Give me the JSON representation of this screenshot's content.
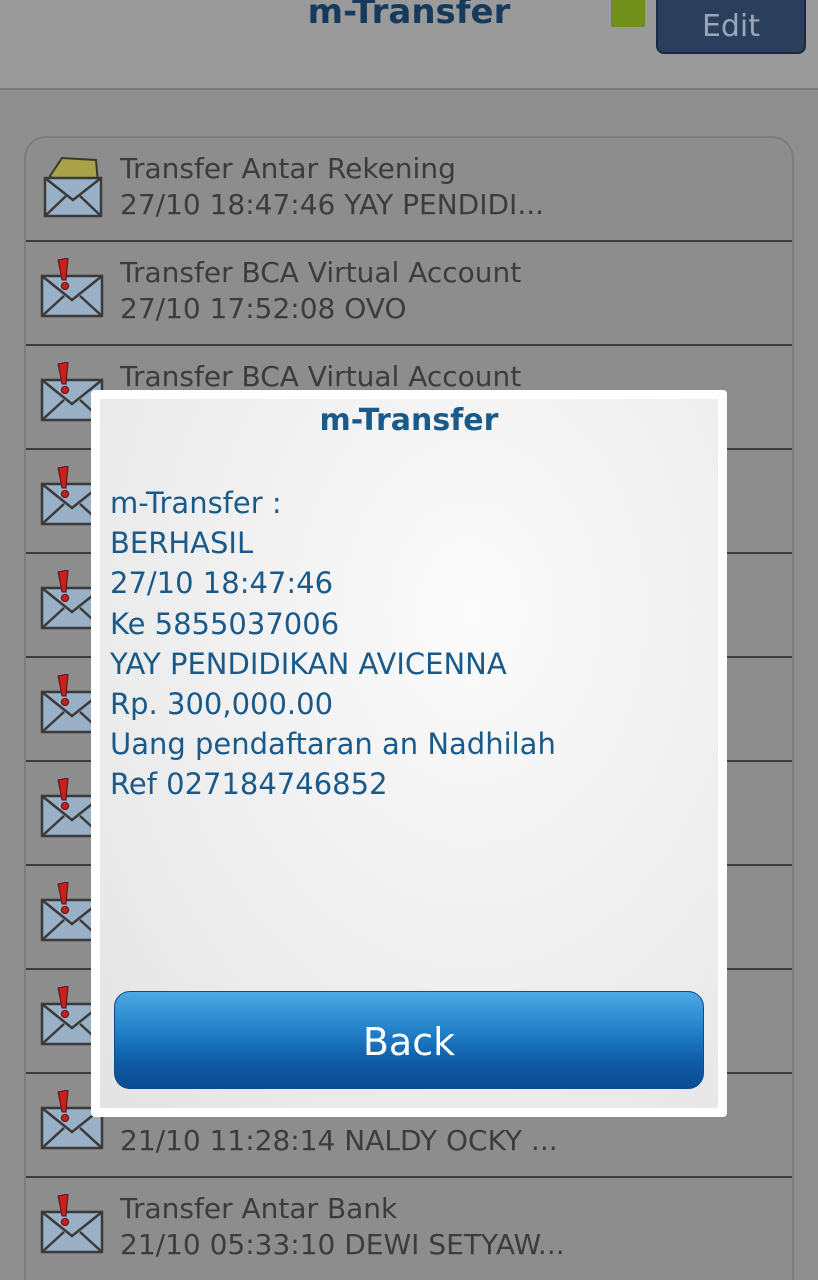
{
  "header": {
    "title": "m-Transfer",
    "edit_label": "Edit",
    "status_color": "#6f8f1a"
  },
  "list": {
    "items": [
      {
        "icon": "envelope-open-icon",
        "title": "Transfer Antar Rekening",
        "sub": "27/10 18:47:46 YAY PENDIDI..."
      },
      {
        "icon": "envelope-alert-icon",
        "title": "Transfer BCA Virtual Account",
        "sub": "27/10 17:52:08 OVO"
      },
      {
        "icon": "envelope-alert-icon",
        "title": "Transfer BCA Virtual Account",
        "sub": ""
      },
      {
        "icon": "envelope-alert-icon",
        "title": "",
        "sub": ""
      },
      {
        "icon": "envelope-alert-icon",
        "title": "",
        "sub": ""
      },
      {
        "icon": "envelope-alert-icon",
        "title": "",
        "sub": ""
      },
      {
        "icon": "envelope-alert-icon",
        "title": "",
        "sub": ""
      },
      {
        "icon": "envelope-alert-icon",
        "title": "",
        "sub": ""
      },
      {
        "icon": "envelope-alert-icon",
        "title": "",
        "sub": ""
      },
      {
        "icon": "envelope-alert-icon",
        "title": "",
        "sub": "21/10 11:28:14 NALDY OCKY ..."
      },
      {
        "icon": "envelope-alert-icon",
        "title": "Transfer Antar Bank",
        "sub": "21/10 05:33:10 DEWI SETYAW..."
      }
    ]
  },
  "dialog": {
    "title": "m-Transfer",
    "lines": [
      "m-Transfer :",
      "BERHASIL",
      "27/10 18:47:46",
      "Ke 5855037006",
      "YAY PENDIDIKAN AVICENNA",
      "Rp. 300,000.00",
      "Uang pendaftaran an Nadhilah",
      "Ref 027184746852"
    ],
    "back_label": "Back"
  }
}
